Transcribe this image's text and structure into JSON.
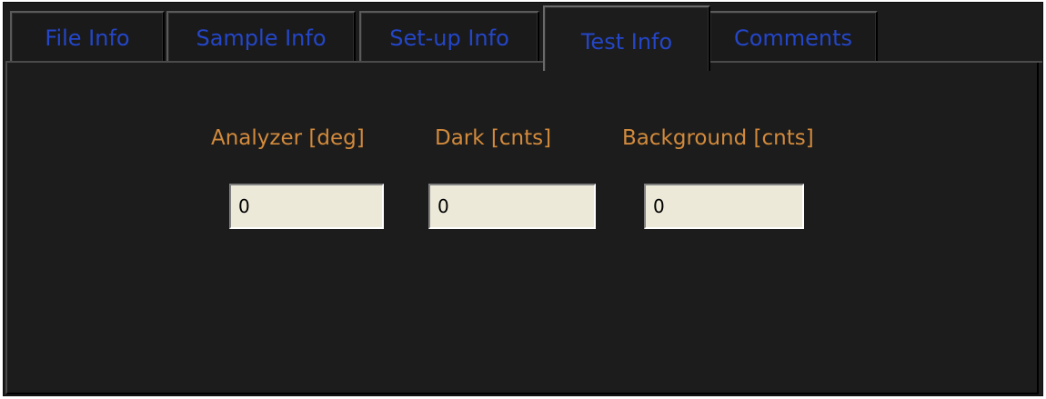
{
  "tabs": [
    {
      "label": "File Info",
      "active": false
    },
    {
      "label": "Sample Info",
      "active": false
    },
    {
      "label": "Set-up Info",
      "active": false
    },
    {
      "label": "Test Info",
      "active": true
    },
    {
      "label": "Comments",
      "active": false
    }
  ],
  "fields": {
    "analyzer": {
      "label": "Analyzer [deg]",
      "value": "0"
    },
    "dark": {
      "label": "Dark  [cnts]",
      "value": "0"
    },
    "background": {
      "label": "Background [cnts]",
      "value": "0"
    }
  },
  "colors": {
    "tab_text": "#2446c8",
    "label_text": "#d28a3c",
    "panel_bg": "#1c1c1c",
    "input_bg": "#ece9d8"
  }
}
